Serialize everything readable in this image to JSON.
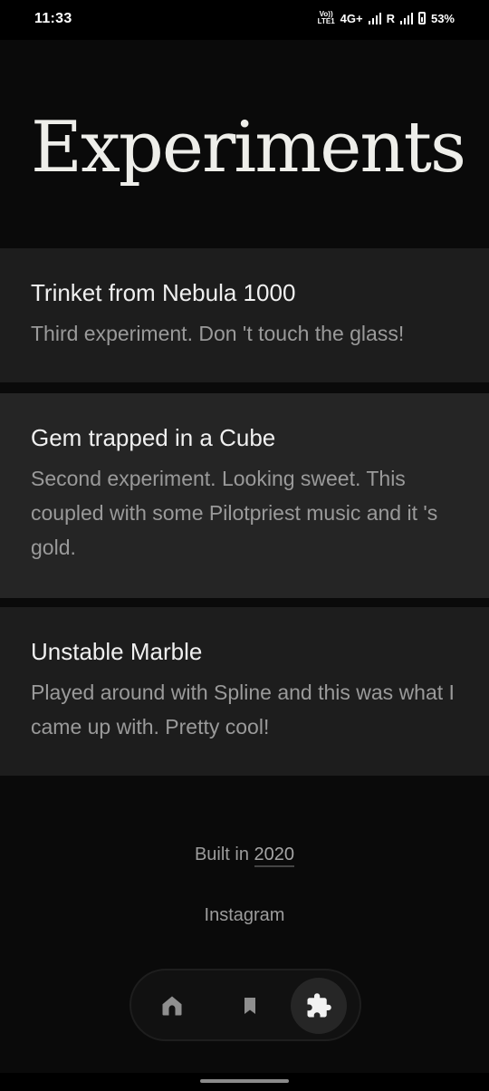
{
  "status_bar": {
    "time": "11:33",
    "volte": "Vo)) LTE1",
    "network": "4G+",
    "roaming": "R",
    "battery": "53%"
  },
  "page": {
    "title": "Experiments"
  },
  "experiments": [
    {
      "title": "Trinket from Nebula 1000",
      "description": "Third experiment. Don 't touch the glass!"
    },
    {
      "title": "Gem trapped in a Cube",
      "description": "Second experiment. Looking sweet. This coupled with some Pilotpriest music and it 's gold."
    },
    {
      "title": "Unstable Marble",
      "description": "Played around with Spline and this was what I came up with. Pretty cool!"
    }
  ],
  "footer": {
    "built_prefix": "Built in",
    "built_year": "2020",
    "instagram": "Instagram"
  },
  "bottom_nav": {
    "items": [
      {
        "icon": "home-icon"
      },
      {
        "icon": "bookmark-icon"
      },
      {
        "icon": "puzzle-icon",
        "active": true
      }
    ]
  },
  "colors": {
    "background": "#0a0a0a",
    "card": "#1d1d1d",
    "card_highlight": "#252525",
    "title_text": "#eeeeea",
    "body_text": "#9a9a9a"
  }
}
